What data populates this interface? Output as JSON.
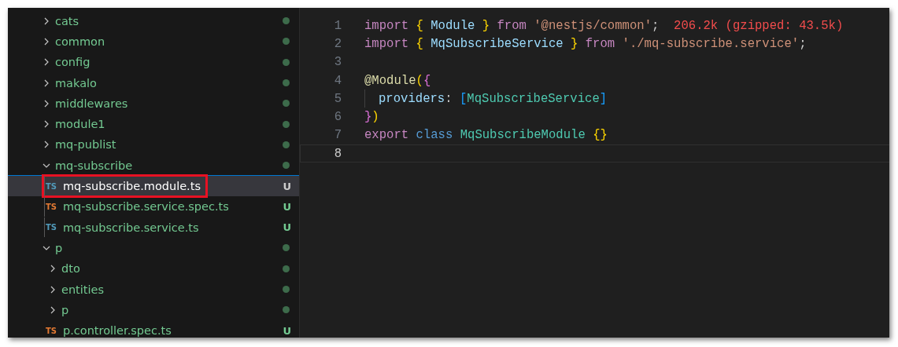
{
  "explorer": {
    "items": [
      {
        "kind": "folder",
        "name": "cats",
        "expanded": false,
        "has_changes": true
      },
      {
        "kind": "folder",
        "name": "common",
        "expanded": false,
        "has_changes": true
      },
      {
        "kind": "folder",
        "name": "config",
        "expanded": false,
        "has_changes": true
      },
      {
        "kind": "folder",
        "name": "makalo",
        "expanded": false,
        "has_changes": true
      },
      {
        "kind": "folder",
        "name": "middlewares",
        "expanded": false,
        "has_changes": true
      },
      {
        "kind": "folder",
        "name": "module1",
        "expanded": false,
        "has_changes": true
      },
      {
        "kind": "folder",
        "name": "mq-publist",
        "expanded": false,
        "has_changes": true
      },
      {
        "kind": "folder",
        "name": "mq-subscribe",
        "expanded": true,
        "has_changes": true,
        "children": [
          {
            "kind": "file",
            "name": "mq-subscribe.module.ts",
            "icon_text": "TS",
            "color": "#519aba",
            "selected": true,
            "highlighted": true,
            "git_status": "U"
          },
          {
            "kind": "file",
            "name": "mq-subscribe.service.spec.ts",
            "icon_text": "TS",
            "color": "#e37933",
            "selected": false,
            "highlighted": false,
            "git_status": "U"
          },
          {
            "kind": "file",
            "name": "mq-subscribe.service.ts",
            "icon_text": "TS",
            "color": "#519aba",
            "selected": false,
            "highlighted": false,
            "git_status": "U"
          }
        ]
      },
      {
        "kind": "folder",
        "name": "p",
        "expanded": true,
        "has_changes": true,
        "children": [
          {
            "kind": "folder",
            "name": "dto",
            "expanded": false,
            "has_changes": true
          },
          {
            "kind": "folder",
            "name": "entities",
            "expanded": false,
            "has_changes": true
          },
          {
            "kind": "folder",
            "name": "p",
            "expanded": false,
            "has_changes": true
          },
          {
            "kind": "file",
            "name": "p.controller.spec.ts",
            "icon_text": "TS",
            "color": "#e37933",
            "selected": false,
            "highlighted": false,
            "git_status": "U"
          }
        ]
      }
    ]
  },
  "editor": {
    "lines": [
      {
        "number": "1",
        "current": false,
        "tokens": [
          {
            "kind": "keyword",
            "text": "import "
          },
          {
            "kind": "brace",
            "text": "{"
          },
          {
            "kind": "variable",
            "text": " Module "
          },
          {
            "kind": "brace",
            "text": "} "
          },
          {
            "kind": "keyword",
            "text": "from "
          },
          {
            "kind": "string",
            "text": "'@nestjs/common'"
          },
          {
            "kind": "plain",
            "text": ";"
          },
          {
            "kind": "annotation",
            "text": "  206.2k (gzipped: 43.5k)"
          }
        ]
      },
      {
        "number": "2",
        "current": false,
        "tokens": [
          {
            "kind": "keyword",
            "text": "import "
          },
          {
            "kind": "brace",
            "text": "{"
          },
          {
            "kind": "variable",
            "text": " MqSubscribeService "
          },
          {
            "kind": "brace",
            "text": "} "
          },
          {
            "kind": "keyword",
            "text": "from "
          },
          {
            "kind": "string",
            "text": "'./mq-subscribe.service'"
          },
          {
            "kind": "plain",
            "text": ";"
          }
        ]
      },
      {
        "number": "3",
        "current": false
      },
      {
        "number": "4",
        "current": false,
        "tokens": [
          {
            "kind": "decorator",
            "text": "@Module"
          },
          {
            "kind": "brace",
            "text": "("
          },
          {
            "kind": "brace2",
            "text": "{"
          }
        ]
      },
      {
        "number": "5",
        "current": false,
        "indent": true,
        "tokens": [
          {
            "kind": "variable",
            "text": "providers"
          },
          {
            "kind": "plain",
            "text": ": "
          },
          {
            "kind": "bracket",
            "text": "["
          },
          {
            "kind": "class",
            "text": "MqSubscribeService"
          },
          {
            "kind": "bracket",
            "text": "]"
          }
        ]
      },
      {
        "number": "6",
        "current": false,
        "tokens": [
          {
            "kind": "brace2",
            "text": "}"
          },
          {
            "kind": "brace",
            "text": ")"
          }
        ]
      },
      {
        "number": "7",
        "current": false,
        "tokens": [
          {
            "kind": "keyword",
            "text": "export "
          },
          {
            "kind": "storage",
            "text": "class "
          },
          {
            "kind": "class",
            "text": "MqSubscribeModule "
          },
          {
            "kind": "brace",
            "text": "{}"
          }
        ]
      },
      {
        "number": "8",
        "current": true
      }
    ]
  }
}
